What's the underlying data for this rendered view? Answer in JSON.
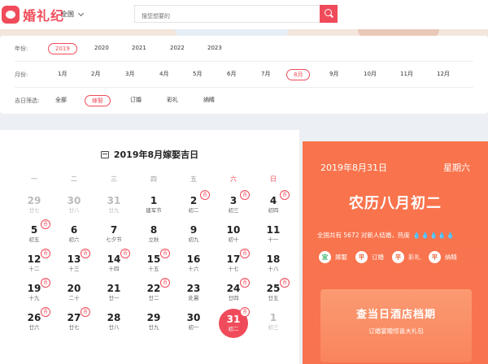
{
  "brand": {
    "name": "婚礼纪",
    "color": "#f04b5a"
  },
  "header": {
    "city": "全国",
    "search_placeholder": "搜您想要的"
  },
  "filters": {
    "year": {
      "label": "年份:",
      "options": [
        "2019",
        "2020",
        "2021",
        "2022",
        "2023"
      ],
      "selected": "2019"
    },
    "month": {
      "label": "月份:",
      "options": [
        "1月",
        "2月",
        "3月",
        "4月",
        "5月",
        "6月",
        "7月",
        "8月",
        "9月",
        "10月",
        "11月",
        "12月"
      ],
      "selected": "8月"
    },
    "type": {
      "label": "吉日筛选:",
      "options": [
        "全部",
        "嫁娶",
        "订婚",
        "彩礼",
        "纳睛"
      ],
      "selected": "嫁娶"
    }
  },
  "calendar": {
    "title": "2019年8月嫁娶吉日",
    "weekdays": [
      "一",
      "二",
      "三",
      "四",
      "五",
      "六",
      "日"
    ],
    "weeks": [
      [
        {
          "n": "29",
          "s": "廿七",
          "dim": true
        },
        {
          "n": "30",
          "s": "廿八",
          "dim": true
        },
        {
          "n": "31",
          "s": "廿九",
          "dim": true
        },
        {
          "n": "1",
          "s": "建军节"
        },
        {
          "n": "2",
          "s": "初二",
          "ji": true
        },
        {
          "n": "3",
          "s": "初三",
          "ji": true
        },
        {
          "n": "4",
          "s": "初四",
          "ji": true
        }
      ],
      [
        {
          "n": "5",
          "s": "初五",
          "ji": true
        },
        {
          "n": "6",
          "s": "初六"
        },
        {
          "n": "7",
          "s": "七夕节"
        },
        {
          "n": "8",
          "s": "立秋"
        },
        {
          "n": "9",
          "s": "初九"
        },
        {
          "n": "10",
          "s": "初十"
        },
        {
          "n": "11",
          "s": "十一"
        }
      ],
      [
        {
          "n": "12",
          "s": "十二",
          "ji": true
        },
        {
          "n": "13",
          "s": "十三",
          "ji": true
        },
        {
          "n": "14",
          "s": "十四",
          "ji": true
        },
        {
          "n": "15",
          "s": "十五",
          "ji": true
        },
        {
          "n": "16",
          "s": "十六"
        },
        {
          "n": "17",
          "s": "十七",
          "ji": true
        },
        {
          "n": "18",
          "s": "十八"
        }
      ],
      [
        {
          "n": "19",
          "s": "十九",
          "ji": true
        },
        {
          "n": "20",
          "s": "二十"
        },
        {
          "n": "21",
          "s": "廿一"
        },
        {
          "n": "22",
          "s": "廿二",
          "ji": true
        },
        {
          "n": "23",
          "s": "处暑"
        },
        {
          "n": "24",
          "s": "廿四",
          "ji": true
        },
        {
          "n": "25",
          "s": "廿五",
          "ji": true
        }
      ],
      [
        {
          "n": "26",
          "s": "廿六",
          "ji": true
        },
        {
          "n": "27",
          "s": "廿七",
          "ji": true
        },
        {
          "n": "28",
          "s": "廿八"
        },
        {
          "n": "29",
          "s": "廿九"
        },
        {
          "n": "30",
          "s": "初一"
        },
        {
          "n": "31",
          "s": "初二",
          "ji": true,
          "today": true
        },
        {
          "n": "1",
          "s": "初三",
          "dim": true
        }
      ]
    ],
    "ji_label": "吉"
  },
  "side": {
    "date": "2019年8月31日",
    "weekday": "星期六",
    "lunar": "农历八月初二",
    "stats": "全国共有 5672 对新人结婚，热度",
    "heat_drops": "💧💧💧💧💧",
    "tags": [
      {
        "badge": "宜",
        "label": "嫁娶",
        "kind": "yi"
      },
      {
        "badge": "平",
        "label": "订婚",
        "kind": "ping"
      },
      {
        "badge": "平",
        "label": "彩礼",
        "kind": "ping"
      },
      {
        "badge": "平",
        "label": "纳睛",
        "kind": "ping"
      }
    ],
    "promo_title": "查当日酒店档期",
    "promo_sub": "订婚宴赠惊喜大礼包",
    "accent": "#f9744c"
  }
}
